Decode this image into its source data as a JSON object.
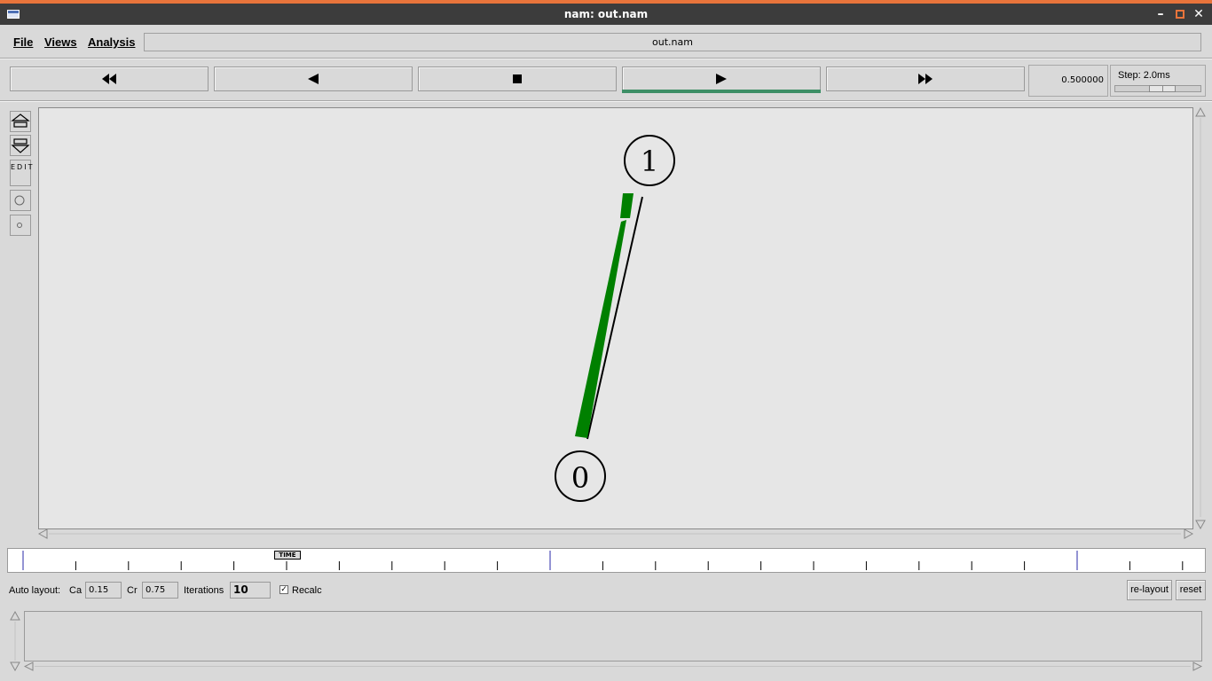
{
  "window": {
    "title": "nam: out.nam",
    "buttons": [
      "minimize",
      "maximize",
      "close"
    ]
  },
  "menu": {
    "file": "File",
    "views": "Views",
    "analysis": "Analysis",
    "filename": "out.nam"
  },
  "transport": {
    "buttons": [
      {
        "name": "rewind",
        "icon": "fast-rewind-icon"
      },
      {
        "name": "back",
        "icon": "play-backward-icon"
      },
      {
        "name": "stop",
        "icon": "stop-icon"
      },
      {
        "name": "play",
        "icon": "play-icon",
        "active": true
      },
      {
        "name": "fast-forward",
        "icon": "fast-forward-icon"
      }
    ],
    "time": "0.500000",
    "step_label": "Step: 2.0ms"
  },
  "tools": {
    "zoom_in": "zoom-in-icon",
    "zoom_out": "zoom-out-icon",
    "edit": "EDIT",
    "node_large": "circle-icon",
    "node_small": "small-circle-icon"
  },
  "nodes": [
    {
      "id": "1"
    },
    {
      "id": "0"
    }
  ],
  "link": {
    "packet_color": "#008000",
    "link_color": "#000000"
  },
  "timeline": {
    "marker": "TIME"
  },
  "auto_layout": {
    "label": "Auto layout:",
    "ca_label": "Ca",
    "ca_value": "0.15",
    "cr_label": "Cr",
    "cr_value": "0.75",
    "iterations_label": "Iterations",
    "iterations_value": "10",
    "recalc_label": "Recalc",
    "recalc_checked": true,
    "relayout": "re-layout",
    "reset": "reset"
  },
  "colors": {
    "accent": "#e8743b",
    "titlebar": "#3c3c3c",
    "play_active": "#3d8f66",
    "background": "#d9d9d9",
    "canvas": "#e6e6e6"
  }
}
